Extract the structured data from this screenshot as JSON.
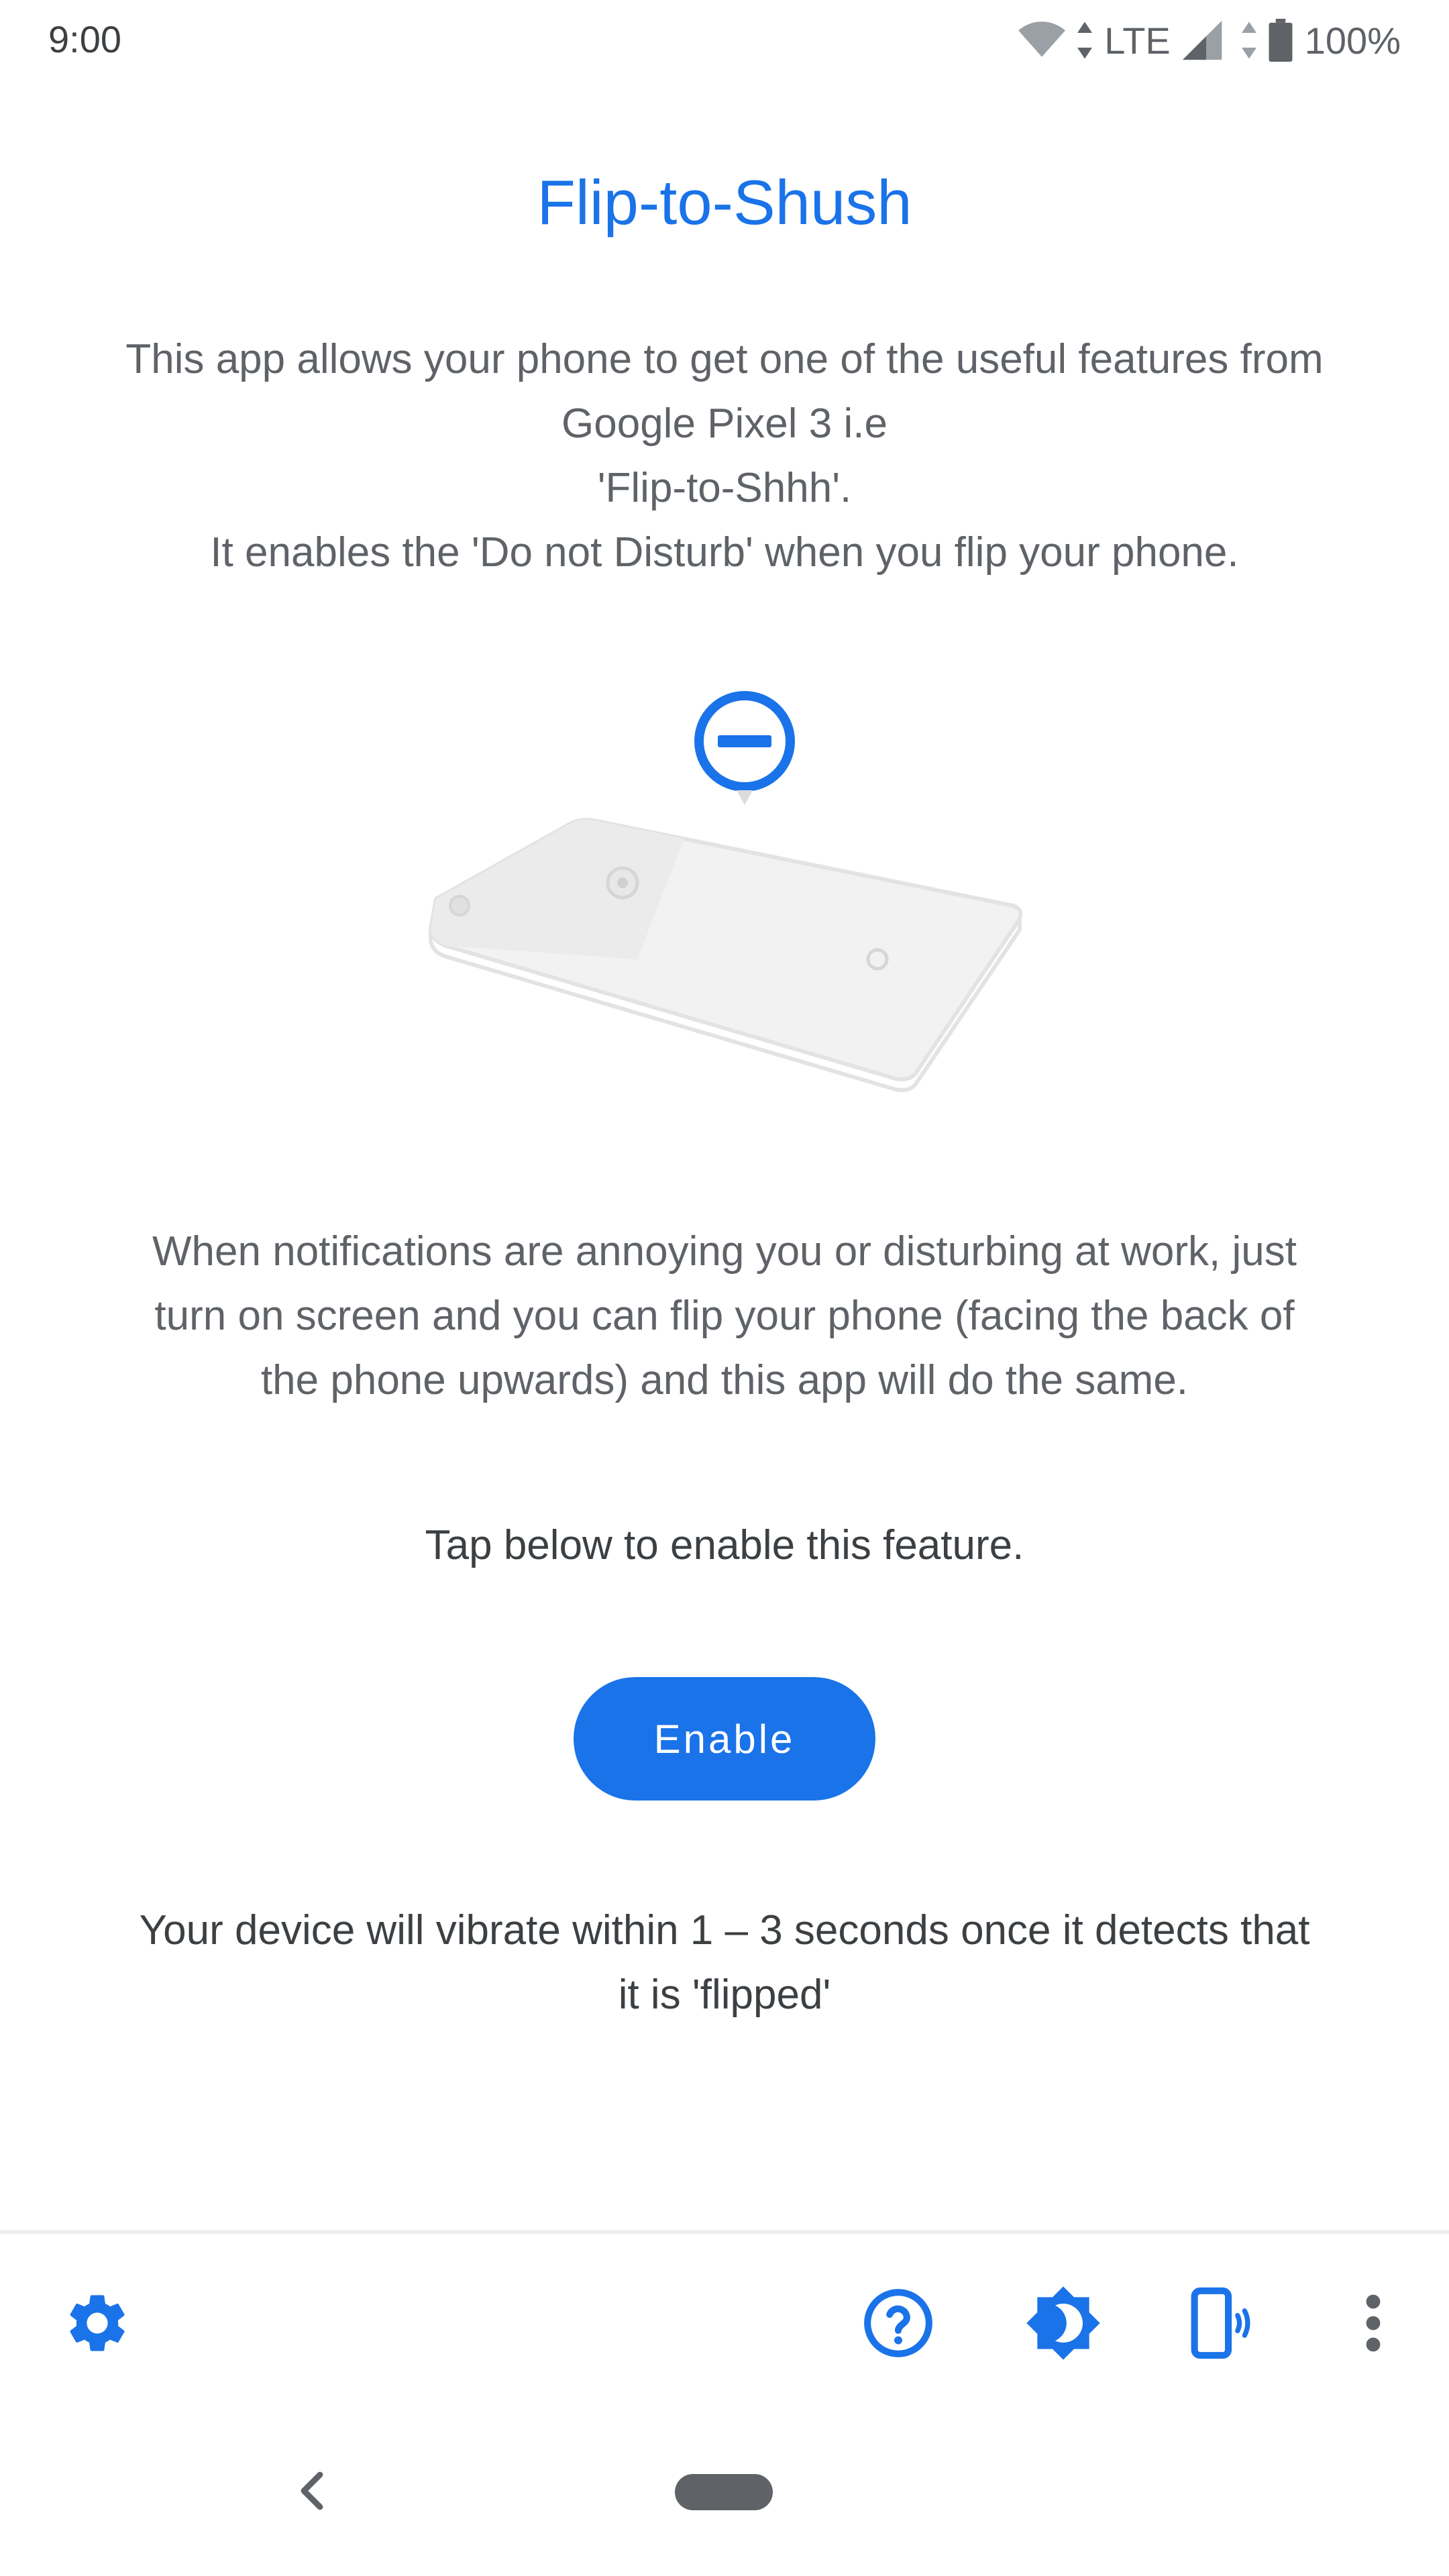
{
  "status_bar": {
    "time": "9:00",
    "network": "LTE",
    "battery": "100%",
    "icons": [
      "wifi-icon",
      "data-arrows-icon",
      "cell-signal-icon",
      "battery-icon"
    ]
  },
  "main": {
    "title": "Flip-to-Shush",
    "description_lines": [
      "This app allows your phone to get one of the useful features from",
      "Google Pixel 3 i.e",
      "'Flip-to-Shhh'.",
      "It enables the 'Do not Disturb' when you flip your phone."
    ],
    "illustration_icon": "do-not-disturb-icon",
    "paragraph_lines": [
      "When notifications are annoying you or disturbing at work, just",
      "turn on screen and you can flip your phone (facing the back of",
      "the phone upwards) and this app will do the same."
    ],
    "tap_text": "Tap below to enable this feature.",
    "enable_label": "Enable",
    "note_lines": [
      "Your device will vibrate within 1 – 3 seconds once it detects that",
      "it is 'flipped'"
    ]
  },
  "toolbar": {
    "icons": [
      "settings-icon",
      "help-icon",
      "brightness-icon",
      "vibrate-icon",
      "more-vert-icon"
    ]
  },
  "colors": {
    "accent": "#1a73e8",
    "text_primary": "#3c4043",
    "text_secondary": "#5f6368",
    "illustration": "#e3e3e3"
  }
}
